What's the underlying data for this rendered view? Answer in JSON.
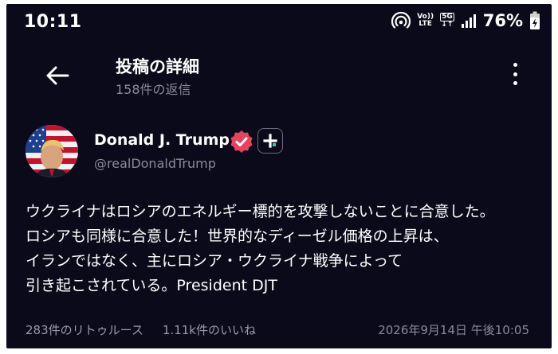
{
  "status_bar": {
    "time": "10:11",
    "volte_line1": "Vo))",
    "volte_line2": "LTE",
    "network": "5G",
    "battery_percent": "76%"
  },
  "header": {
    "title": "投稿の詳細",
    "subtitle": "158件の返信"
  },
  "author": {
    "name": "Donald J. Trump",
    "handle": "@realDonaldTrump"
  },
  "post": {
    "lines": [
      "ウクライナはロシアのエネルギー標的を攻撃しないことに合意した。",
      "ロシアも同様に合意した！世界的なディーゼル価格の上昇は、",
      "イランではなく、主にロシア・ウクライナ戦争によって",
      "引き起こされている。President DJT"
    ]
  },
  "stats": {
    "retruths": "283件のリトゥルース",
    "likes": "1.11k件のいいね"
  },
  "timestamp": "2026年9月14日 午後10:05",
  "colors": {
    "background": "#0b0a1a",
    "verified_badge": "#e8425c",
    "muted_text": "#8a8a99"
  }
}
